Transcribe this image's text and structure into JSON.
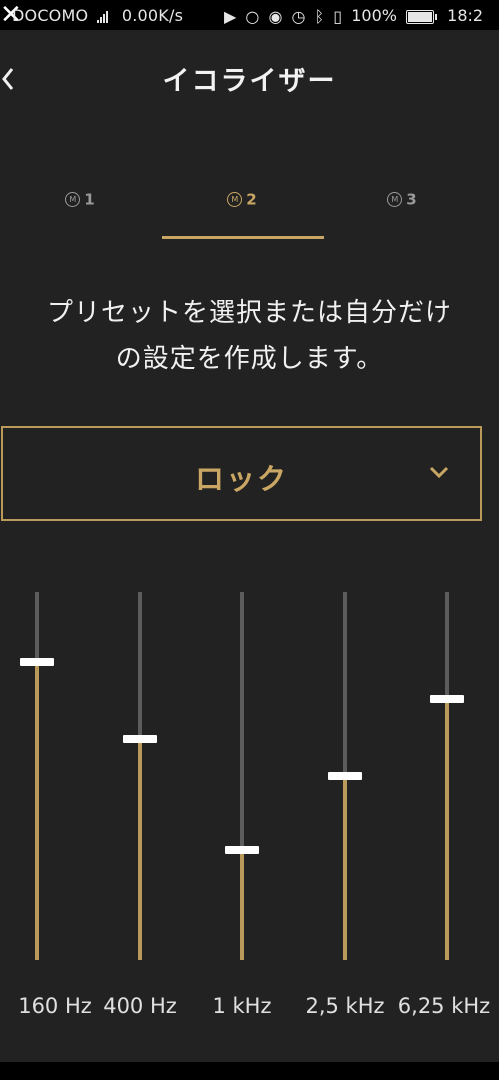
{
  "status_bar": {
    "carrier": "DOCOMO",
    "network": "3G",
    "speed": "0.00K/s",
    "battery": "100%",
    "time": "18:2",
    "icons": [
      "close-x-icon",
      "signal-icon",
      "play-icon",
      "sync-icon",
      "eye-icon",
      "alarm-icon",
      "bluetooth-icon",
      "vibrate-icon",
      "battery-icon"
    ]
  },
  "header": {
    "title": "イコライザー",
    "back_icon": "chevron-left-icon"
  },
  "tabs": [
    {
      "badge": "M",
      "label": "1",
      "active": false
    },
    {
      "badge": "M",
      "label": "2",
      "active": true
    },
    {
      "badge": "M",
      "label": "3",
      "active": false
    }
  ],
  "description": {
    "line1": "プリセットを選択または自分だけ",
    "line2": "の設定を作成します。"
  },
  "preset": {
    "selected": "ロック",
    "icon": "chevron-down-icon"
  },
  "equalizer": {
    "bands": [
      {
        "label": "160 Hz",
        "level": 0.81
      },
      {
        "label": "400 Hz",
        "level": 0.6
      },
      {
        "label": "1 kHz",
        "level": 0.3
      },
      {
        "label": "2,5 kHz",
        "level": 0.5
      },
      {
        "label": "6,25 kHz",
        "level": 0.71
      }
    ]
  },
  "colors": {
    "background": "#222222",
    "accent": "#c9a663",
    "track": "#5c5c5c",
    "thumb": "#ffffff"
  }
}
